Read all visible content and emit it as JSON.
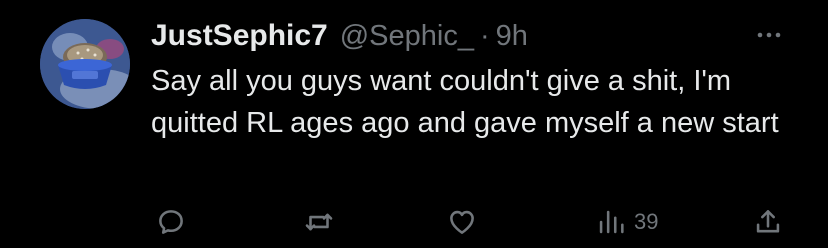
{
  "tweet": {
    "author": {
      "display_name": "JustSephic7",
      "handle": "@Sephic_",
      "avatar_icon": "hedgehog-in-bowl-avatar"
    },
    "separator": "·",
    "time": "9h",
    "text": "Say all you guys want couldn't give a shit, I'm quitted RL ages ago and gave myself a new start",
    "more_icon": "more-dots-icon"
  },
  "actions": {
    "reply": {
      "icon": "reply-icon"
    },
    "retweet": {
      "icon": "retweet-icon"
    },
    "like": {
      "icon": "heart-icon"
    },
    "views": {
      "icon": "views-bar-chart-icon",
      "count": "39"
    },
    "share": {
      "icon": "share-icon"
    }
  },
  "colors": {
    "background": "#000000",
    "primary_text": "#e7e9ea",
    "secondary_text": "#71767b"
  }
}
